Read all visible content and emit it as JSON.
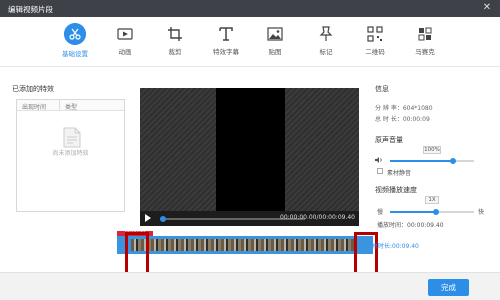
{
  "window": {
    "title": "编辑视频片段",
    "close_glyph": "✕"
  },
  "toolbar": {
    "items": [
      {
        "label": "基础设置",
        "icon": "scissors-icon",
        "active": true
      },
      {
        "label": "动画",
        "icon": "animation-icon",
        "active": false
      },
      {
        "label": "裁剪",
        "icon": "crop-icon",
        "active": false
      },
      {
        "label": "特效字幕",
        "icon": "text-icon",
        "active": false
      },
      {
        "label": "贴图",
        "icon": "image-icon",
        "active": false
      },
      {
        "label": "标记",
        "icon": "pin-icon",
        "active": false
      },
      {
        "label": "二维码",
        "icon": "qrcode-icon",
        "active": false
      },
      {
        "label": "马赛克",
        "icon": "mosaic-icon",
        "active": false
      }
    ]
  },
  "effects_panel": {
    "heading": "已添加的特效",
    "columns": [
      "出现时间",
      "类型"
    ],
    "empty_text": "尚未添加特效"
  },
  "player": {
    "timecode": "00:00:00.00/00:00:09.40",
    "progress": 0.0
  },
  "info": {
    "heading": "信息",
    "resolution_label": "分 辨 率：",
    "resolution_value": "604*1080",
    "duration_label": "总 时 长：",
    "duration_value": "00:00:09"
  },
  "volume": {
    "heading": "原声音量",
    "value_text": "100%",
    "level": 0.75,
    "mute_label": "素材静音",
    "muted": false
  },
  "speed": {
    "heading": "视频播放速度",
    "value_text": "1X",
    "slow_label": "慢",
    "fast_label": "快",
    "level": 0.55,
    "playtime_label": "播放时间：",
    "playtime_value": "00:00:09.40"
  },
  "timeline": {
    "duration_text": "总时长:00:09.40",
    "tag_text": "00:00:00"
  },
  "footer": {
    "done_label": "完成"
  },
  "colors": {
    "accent": "#2d8ee8",
    "highlight": "#b40000",
    "titlebar": "#3e4147"
  }
}
